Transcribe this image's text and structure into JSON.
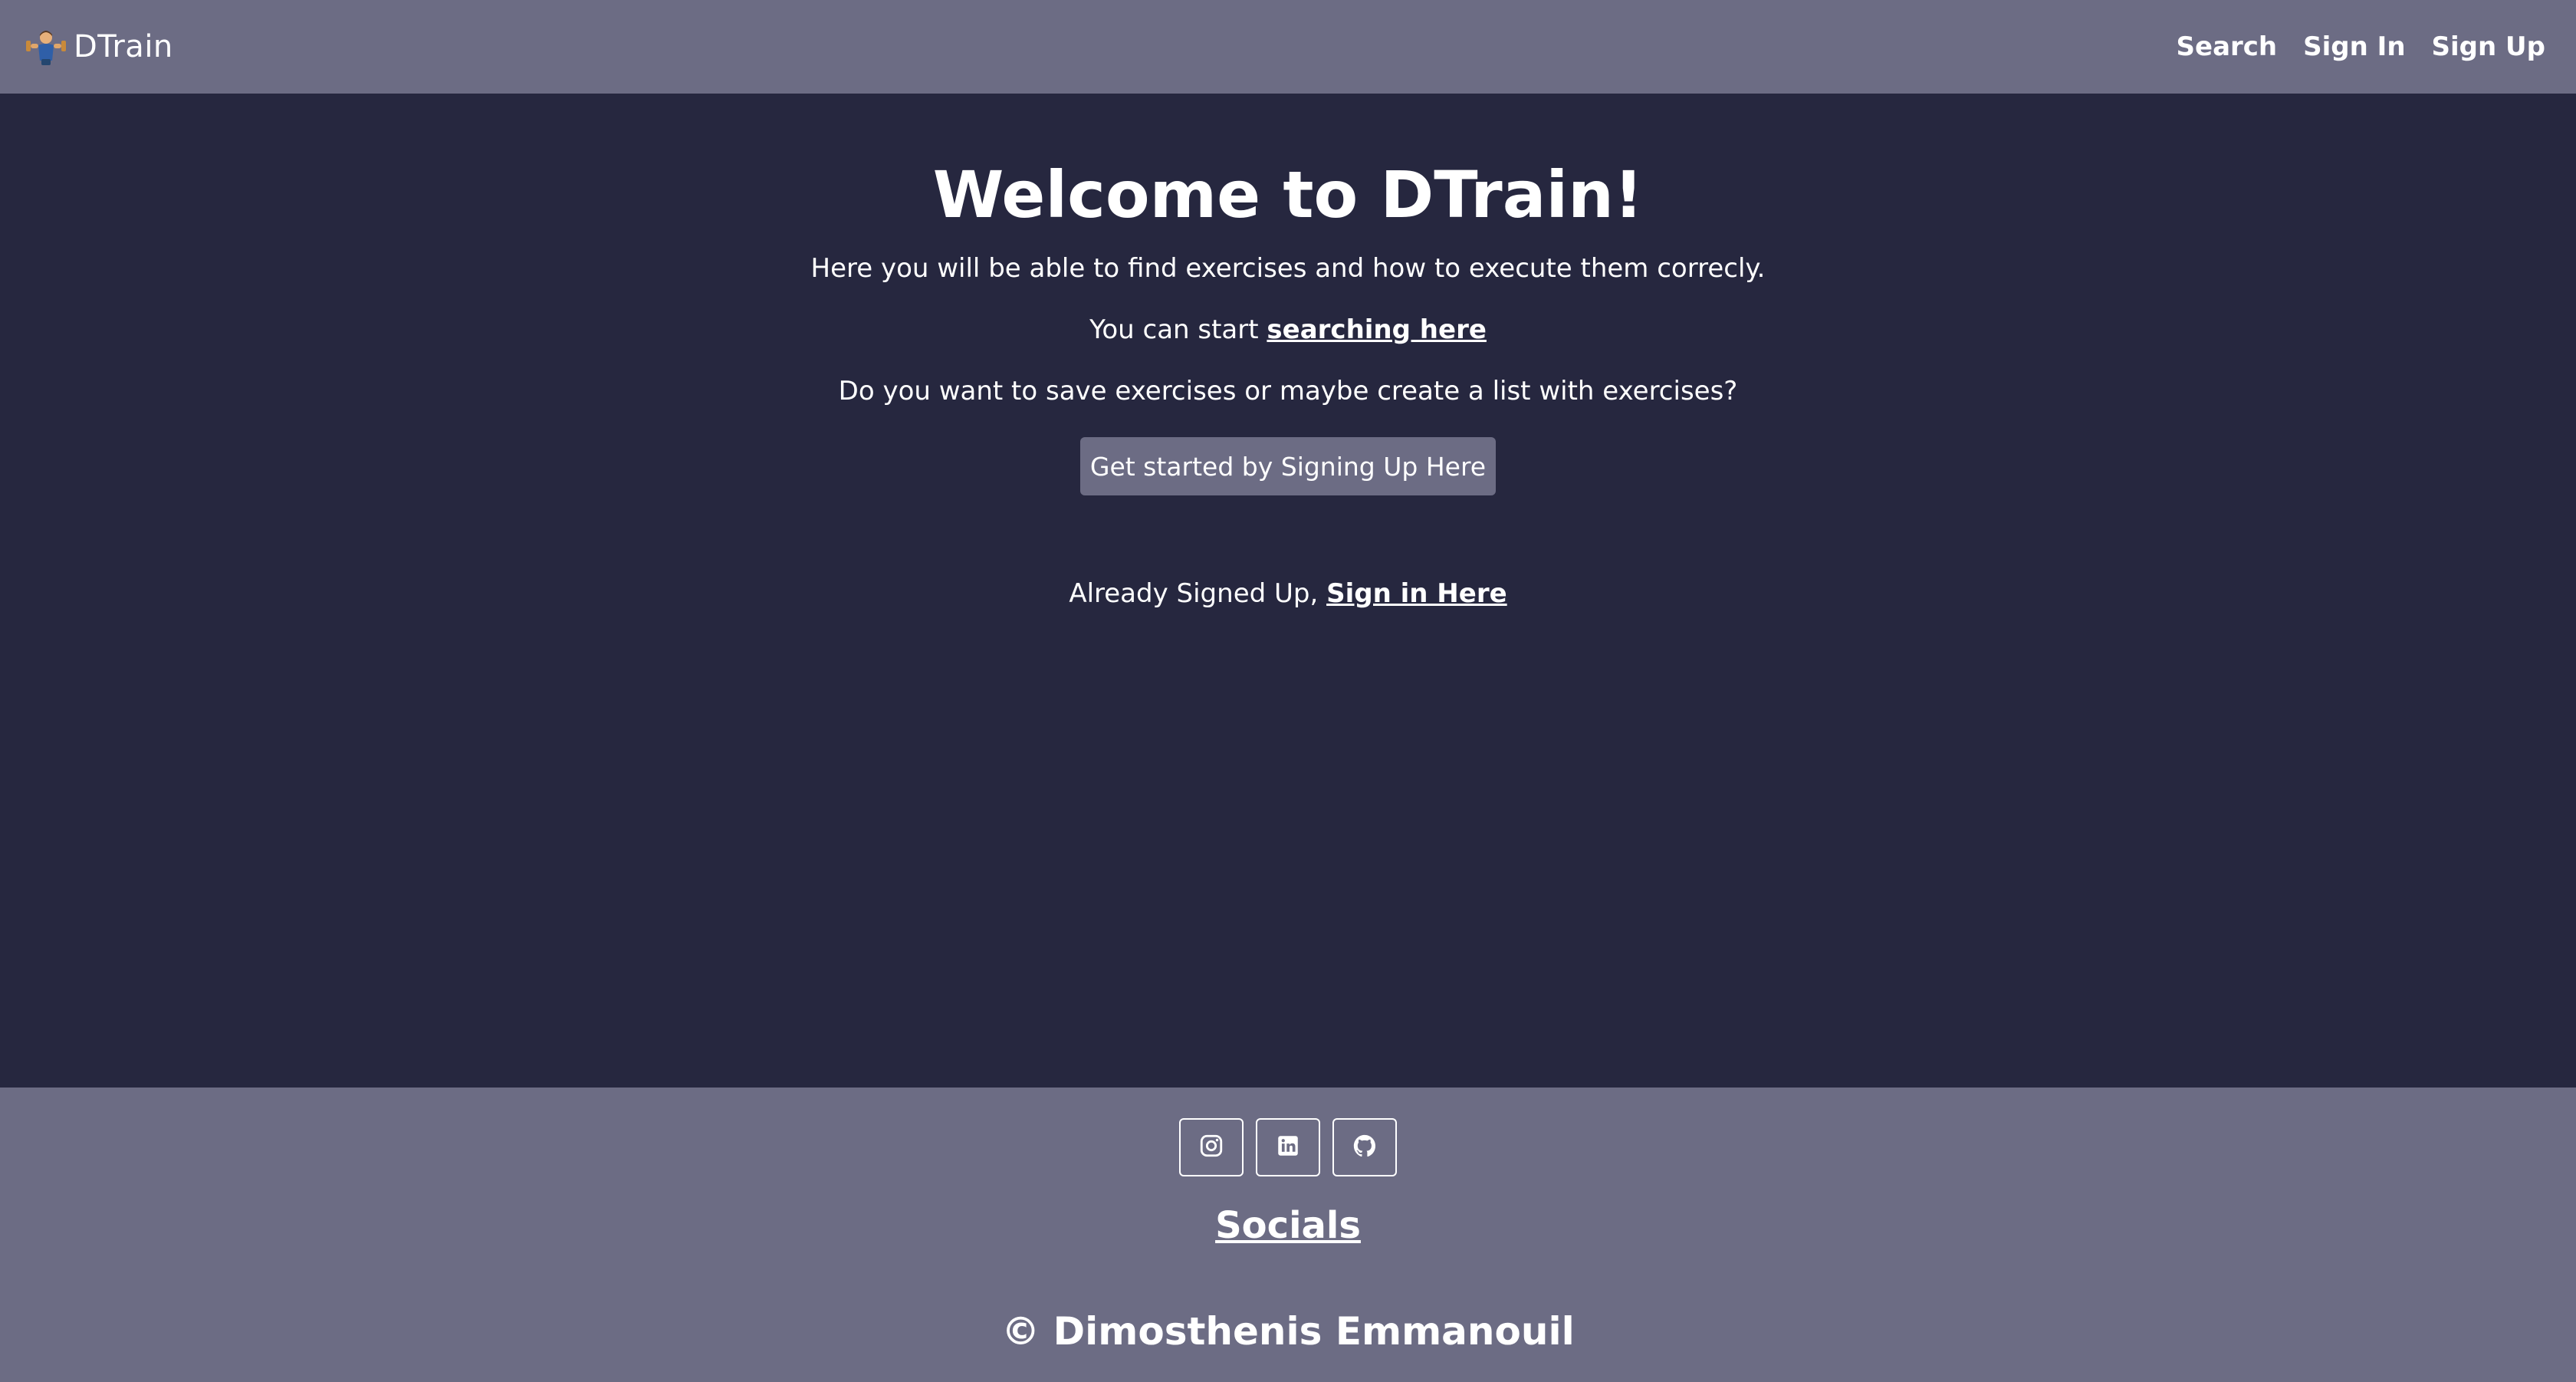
{
  "navbar": {
    "brand": "DTrain",
    "links": [
      "Search",
      "Sign In",
      "Sign Up"
    ]
  },
  "main": {
    "title": "Welcome to DTrain!",
    "intro": "Here you will be able to find exercises and how to execute them correcly.",
    "search_prefix": "You can start",
    "search_link": "searching here",
    "save_question": "Do you want to save exercises or maybe create a list with exercises?",
    "cta_button": "Get started by Signing Up Here",
    "signin_prefix": "Already Signed Up,",
    "signin_link": "Sign in Here"
  },
  "footer": {
    "social_icons": [
      "instagram-icon",
      "linkedin-icon",
      "github-icon"
    ],
    "socials_heading": "Socials",
    "copyright": "© Dimosthenis Emmanouil"
  },
  "colors": {
    "background": "#26273f",
    "navbar_footer": "#6c6c84",
    "text": "#ffffff"
  }
}
